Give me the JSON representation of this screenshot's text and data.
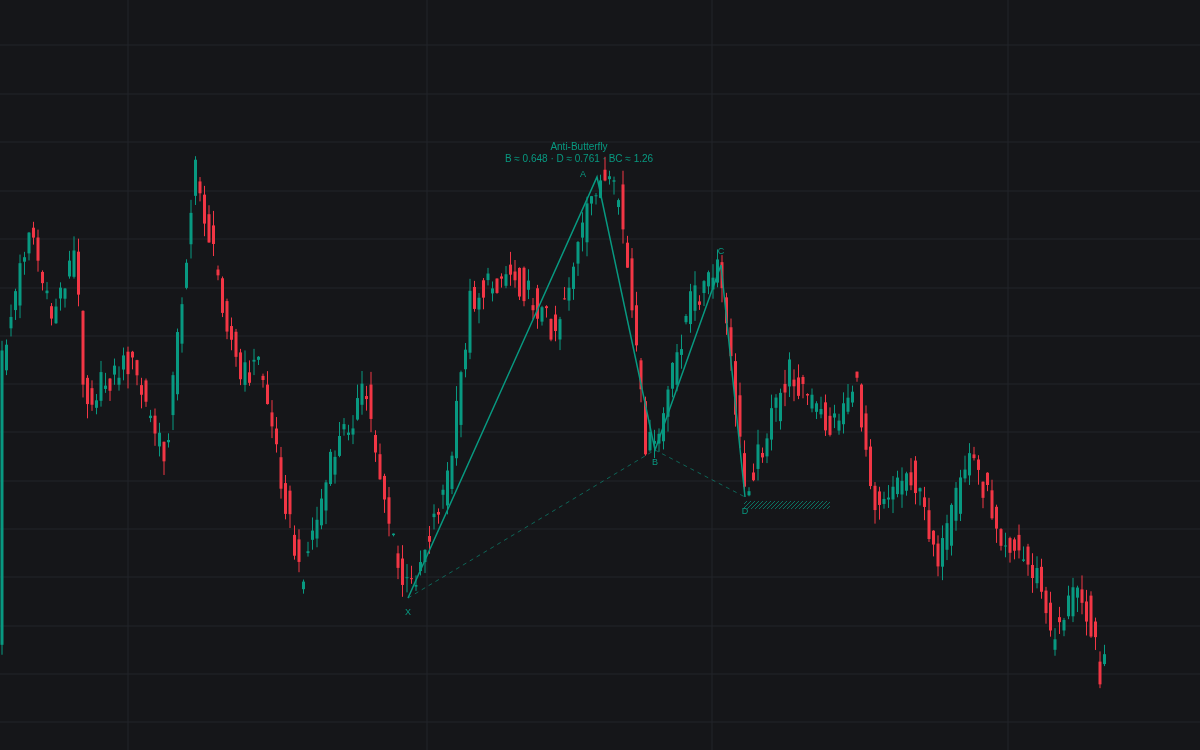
{
  "pattern": {
    "name": "Anti-Butterfly",
    "ratios": "B ≈ 0.648 · D ≈ 0.761 · BC ≈ 1.26",
    "points": [
      {
        "label": "X"
      },
      {
        "label": "A"
      },
      {
        "label": "B"
      },
      {
        "label": "C"
      },
      {
        "label": "D"
      }
    ]
  }
}
